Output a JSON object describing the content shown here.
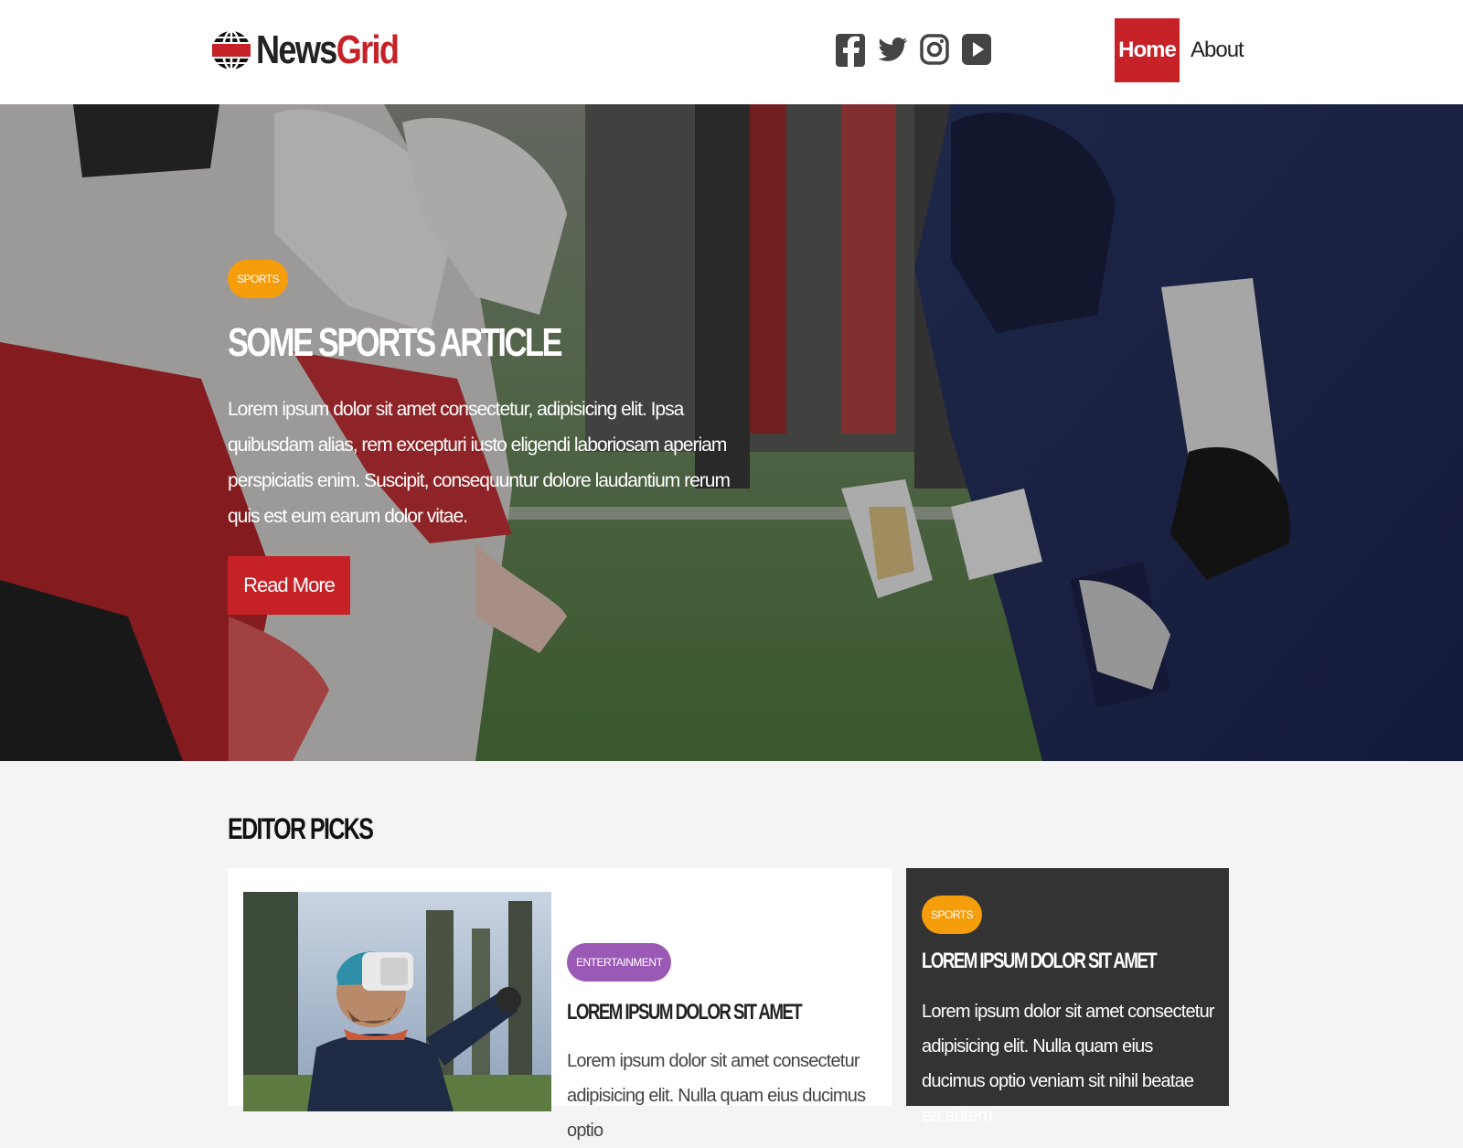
{
  "header": {
    "logo_part1": "News",
    "logo_part2": "Grid",
    "social": [
      "facebook-icon",
      "twitter-icon",
      "instagram-icon",
      "youtube-icon"
    ],
    "nav": [
      {
        "label": "Home",
        "active": true
      },
      {
        "label": "About",
        "active": false
      }
    ]
  },
  "hero": {
    "category": "SPORTS",
    "title": "Some Sports Article",
    "text": "Lorem ipsum dolor sit amet consectetur, adipisicing elit. Ipsa quibusdam alias, rem excepturi iusto eligendi laboriosam aperiam perspiciatis enim. Suscipit, consequuntur dolore laudantium rerum quis est eum earum dolor vitae.",
    "button": "Read More"
  },
  "editor_picks": {
    "title": "Editor Picks",
    "main_card": {
      "category": "ENTERTAINMENT",
      "title": "Lorem ipsum dolor sit amet",
      "text": "Lorem ipsum dolor sit amet consectetur adipisicing elit. Nulla quam eius ducimus optio"
    },
    "side_card": {
      "category": "SPORTS",
      "title": "Lorem ipsum dolor sit amet",
      "text": "Lorem ipsum dolor sit amet consectetur adipisicing elit. Nulla quam eius ducimus optio veniam sit nihil beatae ea autem."
    }
  },
  "colors": {
    "brand_red": "#c62127",
    "sports_orange": "#f59d0b",
    "entertainment_purple": "#9b59b6",
    "dark_card": "#333333"
  }
}
